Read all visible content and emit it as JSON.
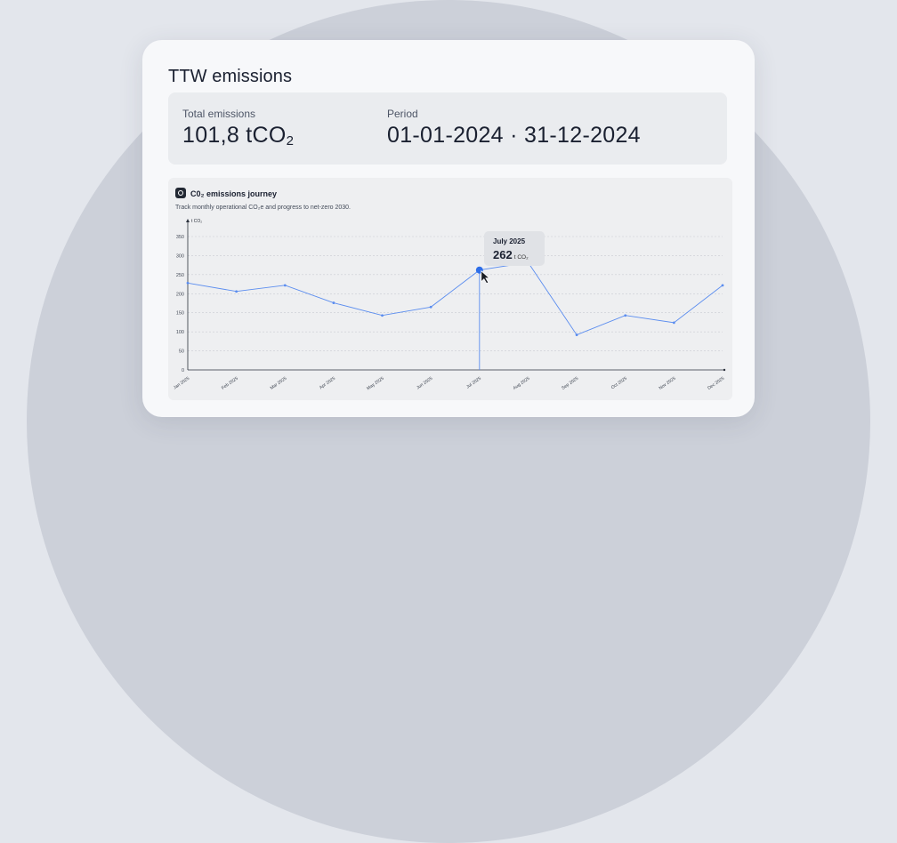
{
  "card": {
    "title": "TTW emissions",
    "total_label": "Total emissions",
    "total_value": "101,8 tCO",
    "total_value_sub": "2",
    "period_label": "Period",
    "period_value": "01-01-2024 · 31-12-2024"
  },
  "chart_panel": {
    "icon": "leaf-icon",
    "title": "C0₂ emissions journey",
    "subtitle": "Track monthly operational CO₂e and progress to net-zero 2030."
  },
  "chart_data": {
    "type": "line",
    "ylabel": "t CO₂",
    "ylim": [
      0,
      350
    ],
    "yticks": [
      0,
      50,
      100,
      150,
      200,
      250,
      300,
      350
    ],
    "grid": true,
    "categories": [
      "Jan 2025",
      "Feb 2025",
      "Mar 2025",
      "Apr 2025",
      "May 2025",
      "Jun 2025",
      "Jul 2025",
      "Aug 2025",
      "Sep 2025",
      "Oct 2025",
      "Nov 2025",
      "Dec 2025"
    ],
    "values": [
      228,
      206,
      222,
      176,
      143,
      165,
      262,
      282,
      92,
      143,
      124,
      222
    ],
    "line_color": "#5b8def",
    "highlight_index": 6
  },
  "tooltip": {
    "title": "July 2025",
    "value": "262",
    "unit": "t CO₂"
  }
}
